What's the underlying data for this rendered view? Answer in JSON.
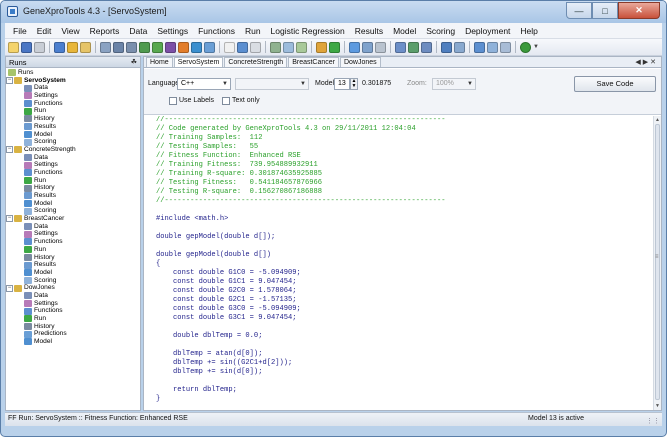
{
  "window": {
    "title": "GeneXproTools 4.3 - [ServoSystem]"
  },
  "menu": [
    "File",
    "Edit",
    "View",
    "Reports",
    "Data",
    "Settings",
    "Functions",
    "Run",
    "Logistic Regression",
    "Results",
    "Model",
    "Scoring",
    "Deployment",
    "Help"
  ],
  "runs_panel": {
    "title": "Runs",
    "root": "Runs",
    "groups": [
      {
        "name": "ServoSystem",
        "items": [
          "Data",
          "Settings",
          "Functions",
          "Run",
          "History",
          "Results",
          "Model",
          "Scoring"
        ]
      },
      {
        "name": "ConcreteStrength",
        "items": [
          "Data",
          "Settings",
          "Functions",
          "Run",
          "History",
          "Results",
          "Model",
          "Scoring"
        ]
      },
      {
        "name": "BreastCancer",
        "items": [
          "Data",
          "Settings",
          "Functions",
          "Run",
          "History",
          "Results",
          "Model",
          "Scoring"
        ]
      },
      {
        "name": "DowJones",
        "items": [
          "Data",
          "Settings",
          "Functions",
          "Run",
          "History",
          "Predictions",
          "Model"
        ]
      }
    ]
  },
  "tabs": [
    "Home",
    "ServoSystem",
    "ConcreteStrength",
    "BreastCancer",
    "DowJones"
  ],
  "options": {
    "language_label": "Language:",
    "language_value": "C++",
    "model_label": "Model:",
    "model_value": "13",
    "fitness_value": "0.301875",
    "zoom_label": "Zoom:",
    "zoom_value": "100%",
    "use_labels": "Use Labels",
    "text_only": "Text only",
    "save_button": "Save Code"
  },
  "code_lines": [
    {
      "text": "    //------------------------------------------------------------------",
      "kind": "comment"
    },
    {
      "text": "    // Code generated by GeneXproTools 4.3 on 29/11/2011 12:04:04",
      "kind": "comment"
    },
    {
      "text": "    // Training Samples:  112",
      "kind": "comment"
    },
    {
      "text": "    // Testing Samples:   55",
      "kind": "comment"
    },
    {
      "text": "    // Fitness Function:  Enhanced RSE",
      "kind": "comment"
    },
    {
      "text": "    // Training Fitness:  739.954889932911",
      "kind": "comment"
    },
    {
      "text": "    // Training R-square: 0.301874635925885",
      "kind": "comment"
    },
    {
      "text": "    // Testing Fitness:   0.541184657876966",
      "kind": "comment"
    },
    {
      "text": "    // Testing R-square:  0.156270867186888",
      "kind": "comment"
    },
    {
      "text": "    //------------------------------------------------------------------",
      "kind": "comment"
    },
    {
      "text": "",
      "kind": "normal"
    },
    {
      "text": "    #include <math.h>",
      "kind": "normal"
    },
    {
      "text": "",
      "kind": "normal"
    },
    {
      "text": "    double gepModel(double d[]);",
      "kind": "normal"
    },
    {
      "text": "",
      "kind": "normal"
    },
    {
      "text": "    double gepModel(double d[])",
      "kind": "normal"
    },
    {
      "text": "    {",
      "kind": "normal"
    },
    {
      "text": "        const double G1C0 = -5.094909;",
      "kind": "normal"
    },
    {
      "text": "        const double G1C1 = 9.047454;",
      "kind": "normal"
    },
    {
      "text": "        const double G2C0 = 1.578064;",
      "kind": "normal"
    },
    {
      "text": "        const double G2C1 = -1.57135;",
      "kind": "normal"
    },
    {
      "text": "        const double G3C0 = -5.094909;",
      "kind": "normal"
    },
    {
      "text": "        const double G3C1 = 9.047454;",
      "kind": "normal"
    },
    {
      "text": "",
      "kind": "normal"
    },
    {
      "text": "        double dblTemp = 0.0;",
      "kind": "normal"
    },
    {
      "text": "",
      "kind": "normal"
    },
    {
      "text": "        dblTemp = atan(d[0]);",
      "kind": "normal"
    },
    {
      "text": "        dblTemp += sin((G2C1+d[2]));",
      "kind": "normal"
    },
    {
      "text": "        dblTemp += sin(d[0]);",
      "kind": "normal"
    },
    {
      "text": "",
      "kind": "normal"
    },
    {
      "text": "        return dblTemp;",
      "kind": "normal"
    },
    {
      "text": "    }",
      "kind": "normal"
    }
  ],
  "status": {
    "left": "FF Run: ServoSystem :: Fitness Function: Enhanced RSE",
    "right": "Model 13 is active"
  },
  "colors": {
    "comment": "#2aa02a",
    "code": "#23238c",
    "frame": "#b9d1ea"
  },
  "icons": {
    "toolbar": [
      "open-icon",
      "save-icon",
      "print-icon",
      "cut-icon",
      "copy-icon",
      "paste-icon",
      "undo-icon",
      "settings-icon",
      "data-icon",
      "function-icon",
      "run-icon",
      "stop-icon",
      "chart-icon",
      "model-icon",
      "score-icon",
      "export-icon",
      "help-icon"
    ]
  }
}
